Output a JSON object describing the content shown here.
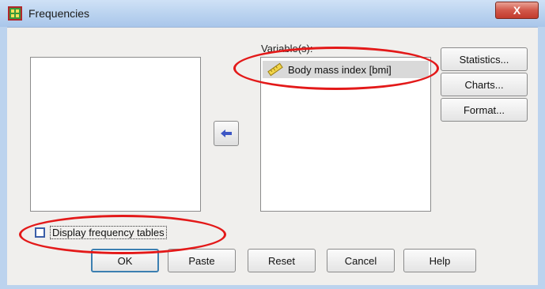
{
  "window": {
    "title": "Frequencies",
    "close_glyph": "X"
  },
  "source_list": {
    "items": []
  },
  "variables": {
    "label": "Variable(s):",
    "items": [
      {
        "name": "Body mass index [bmi]",
        "icon": "ruler-icon"
      }
    ]
  },
  "move_button": {
    "icon": "arrow-left-icon"
  },
  "side_buttons": {
    "statistics": "Statistics...",
    "charts": "Charts...",
    "format": "Format..."
  },
  "checkbox": {
    "label": "Display frequency tables",
    "checked": false
  },
  "buttons": {
    "ok": "OK",
    "paste": "Paste",
    "reset": "Reset",
    "cancel": "Cancel",
    "help": "Help"
  },
  "colors": {
    "annotation": "#e31919",
    "title_bar": "#b9d2ef",
    "close_button": "#c23b2c"
  }
}
